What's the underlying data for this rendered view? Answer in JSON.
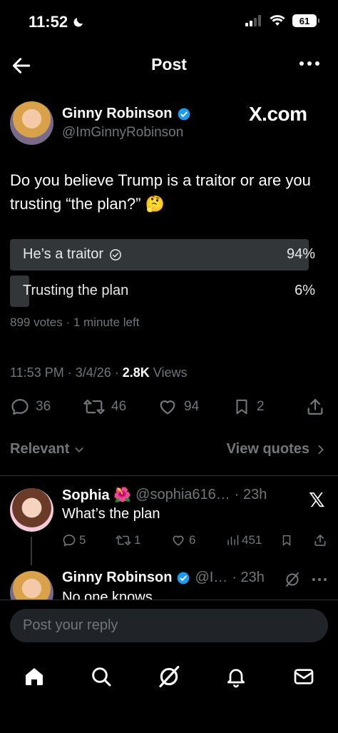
{
  "status_bar": {
    "time": "11:52",
    "battery": "61"
  },
  "header": {
    "title": "Post"
  },
  "post": {
    "author_name": "Ginny Robinson",
    "author_handle": "@ImGinnyRobinson",
    "watermark": "X.com",
    "text": "Do you believe Trump is a traitor or are you trusting “the plan?” 🤔",
    "poll": {
      "options": [
        {
          "label": "He’s a traitor",
          "percent_text": "94%",
          "percent": 94,
          "selected": true
        },
        {
          "label": "Trusting the plan",
          "percent_text": "6%",
          "percent": 6,
          "selected": false
        }
      ],
      "votes": "899 votes",
      "time_left": "1 minute left"
    },
    "timestamp": "11:53 PM · 3/4/26 · ",
    "views_count": "2.8K",
    "views_label": " Views",
    "stats": {
      "replies": "36",
      "reposts": "46",
      "likes": "94",
      "bookmarks": "2"
    }
  },
  "sort": {
    "label": "Relevant",
    "view_quotes": "View quotes"
  },
  "replies": [
    {
      "name": "Sophia 🌺",
      "handle": "@sophia616…",
      "time": "· 23h",
      "text": "What’s the plan",
      "stats": {
        "replies": "5",
        "reposts": "1",
        "likes": "6",
        "views": "451"
      }
    },
    {
      "name": "Ginny Robinson",
      "handle": "@I…",
      "time": "· 23h",
      "text": "No one knows"
    }
  ],
  "composer": {
    "placeholder": "Post your reply"
  },
  "colors": {
    "background": "#000000",
    "text": "#e7e9ea",
    "muted": "#71767b",
    "verified": "#1d9bf0",
    "poll_fill": "#333639"
  }
}
